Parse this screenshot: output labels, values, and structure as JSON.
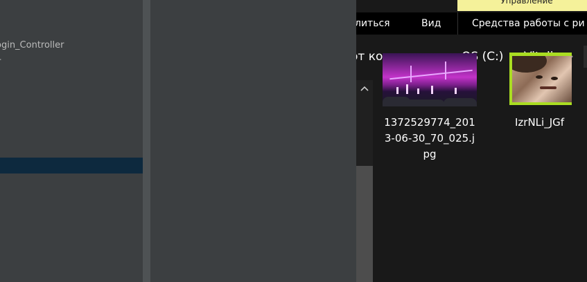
{
  "ide": {
    "tree_items": [
      "ogin_Controller",
      "r"
    ]
  },
  "explorer": {
    "ribbon_context_label": "Управление",
    "tabs": {
      "share": "литься",
      "view": "Вид",
      "picture_tools": "Средства работы с ри"
    },
    "breadcrumb": {
      "pc": "от компьютер",
      "drive": "OS (C:)",
      "folder": "Vitalia",
      "separator": "›"
    },
    "files": [
      {
        "name_lines": [
          "1372529774_201",
          "3-06-30_70_025.j",
          "pg"
        ]
      },
      {
        "name_lines": [
          "IzrNLi_JGf"
        ]
      }
    ]
  },
  "colors": {
    "ide_background": "#3c3f41",
    "ide_selection": "#0d293e",
    "explorer_background": "#191919",
    "ribbon_context": "#f5f19a",
    "selected_thumb_border": "#aadd22"
  },
  "icons": {
    "scroll_up": "chevron-up-icon",
    "breadcrumb_separator": "chevron-right-icon"
  }
}
